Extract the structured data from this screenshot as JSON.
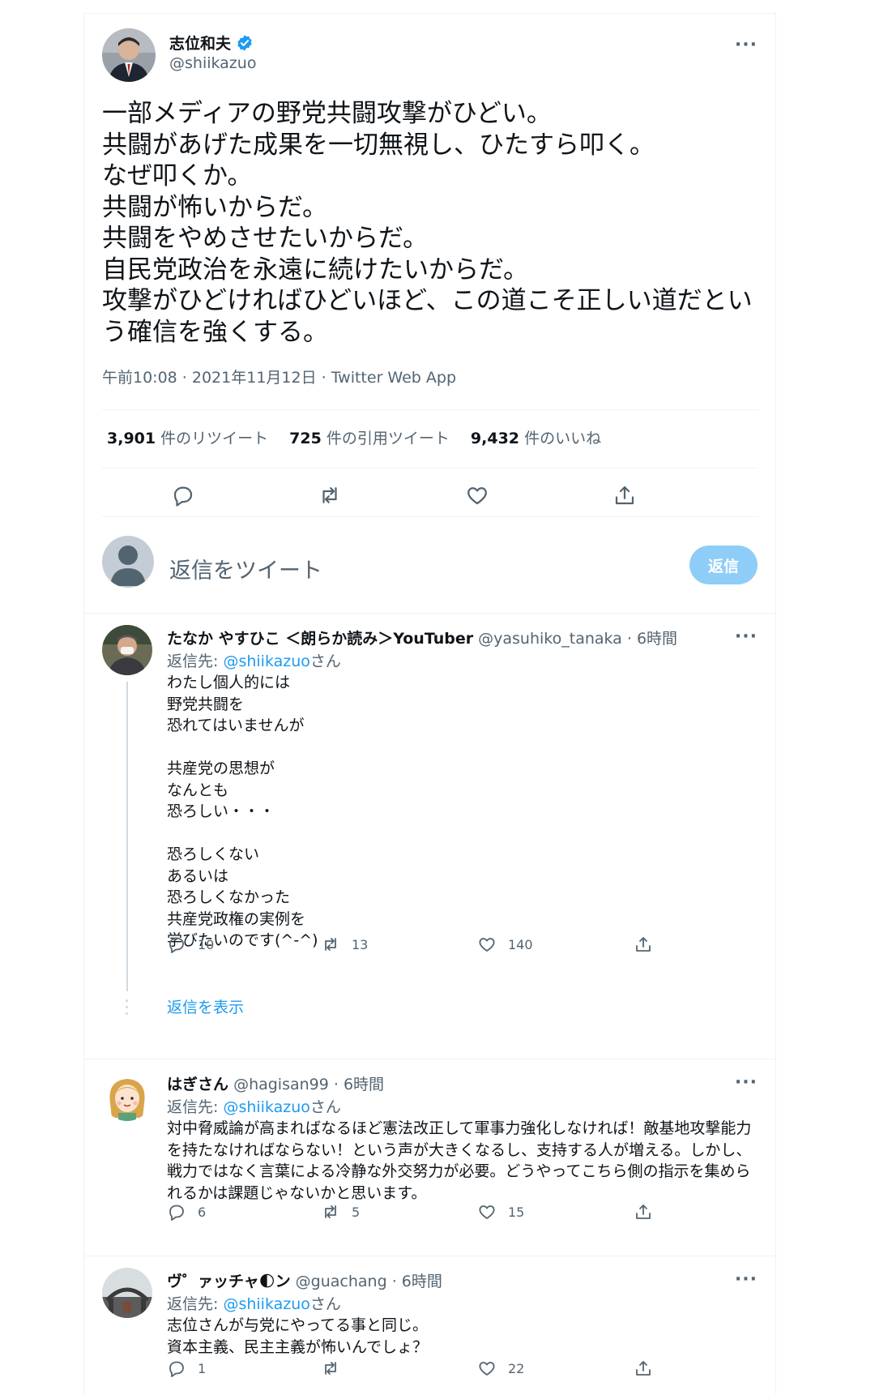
{
  "main_tweet": {
    "author_name": "志位和夫",
    "author_handle": "@shiikazuo",
    "text": "一部メディアの野党共闘攻撃がひどい。\n共闘があげた成果を一切無視し、ひたすら叩く。\nなぜ叩くか。\n共闘が怖いからだ。\n共闘をやめさせたいからだ。\n自民党政治を永遠に続けたいからだ。\n攻撃がひどければひどいほど、この道こそ正しい道だという確信を強くする。",
    "meta": "午前10:08 · 2021年11月12日 · Twitter Web App",
    "stats": {
      "retweets_count": "3,901",
      "retweets_label": "件のリツイート",
      "quotes_count": "725",
      "quotes_label": "件の引用ツイート",
      "likes_count": "9,432",
      "likes_label": "件のいいね"
    }
  },
  "compose": {
    "placeholder": "返信をツイート",
    "button": "返信"
  },
  "replies": [
    {
      "name": "たなか やすひこ ＜朗らか読み＞YouTuber",
      "handle_time": "@yasuhiko_tanaka · 6時間",
      "reply_to_label": "返信先: ",
      "reply_to_mention": "@shiikazuo",
      "reply_to_suffix": "さん",
      "text": "わたし個人的には\n野党共闘を\n恐れてはいませんが\n\n共産党の思想が\nなんとも\n恐ろしい・・・\n\n恐ろしくない\nあるいは\n恐ろしくなかった\n共産党政権の実例を\n学びたいのです(^-^)",
      "reply_count": "10",
      "retweet_count": "13",
      "like_count": "140",
      "show_replies": "返信を表示"
    },
    {
      "name": "はぎさん",
      "handle_time": "@hagisan99 · 6時間",
      "reply_to_label": "返信先: ",
      "reply_to_mention": "@shiikazuo",
      "reply_to_suffix": "さん",
      "text": "対中脅威論が高まればなるほど憲法改正して軍事力強化しなければ！敵基地攻撃能力を持たなければならない！という声が大きくなるし、支持する人が増える。しかし、戦力ではなく言葉による冷静な外交努力が必要。どうやってこちら側の指示を集められるかは課題じゃないかと思います。",
      "reply_count": "6",
      "retweet_count": "5",
      "like_count": "15"
    },
    {
      "name": "ヴ゜ァッチャ🌓ン",
      "handle_time": "@guachang · 6時間",
      "reply_to_label": "返信先: ",
      "reply_to_mention": "@shiikazuo",
      "reply_to_suffix": "さん",
      "text": "志位さんが与党にやってる事と同じ。\n資本主義、民主主義が怖いんでしょ？",
      "reply_count": "1",
      "retweet_count": "",
      "like_count": "22"
    }
  ],
  "colors": {
    "accent": "#1d9bf0",
    "secondary_text": "#536471",
    "divider": "#eff3f4",
    "reply_button": "#8ecdf7"
  }
}
